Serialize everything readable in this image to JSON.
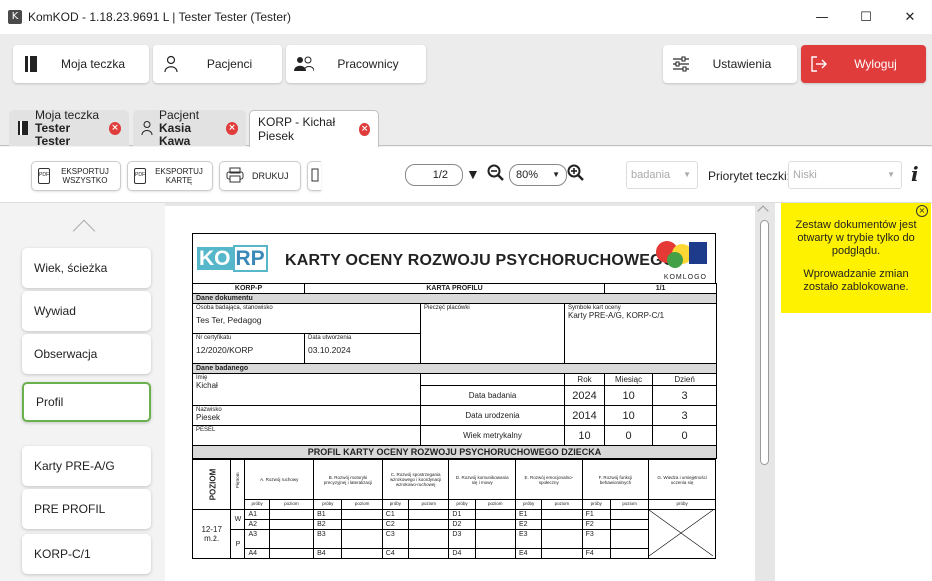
{
  "window": {
    "title": "KomKOD - 1.18.23.9691 L | Tester Tester (Tester)",
    "app_icon": "K",
    "minimize": "—",
    "maximize": "☐",
    "close": "✕"
  },
  "topnav": {
    "moja_teczka": "Moja teczka",
    "pacjenci": "Pacjenci",
    "pracownicy": "Pracownicy",
    "ustawienia": "Ustawienia",
    "wyloguj": "Wyloguj"
  },
  "tabs": [
    {
      "line1": "Moja teczka",
      "line2": "Tester Tester"
    },
    {
      "line1": "Pacjent",
      "line2": "Kasia Kawa"
    },
    {
      "label": "KORP - Kichał Piesek"
    }
  ],
  "toolbar": {
    "export_all": "EKSPORTUJ WSZYSTKO",
    "export_card": "EKSPORTUJ KARTĘ",
    "print": "DRUKUJ",
    "page": "1/2",
    "zoom": "80%",
    "badania_value": "badania",
    "priority_label": "Priorytet teczki:",
    "priority_value": "Niski",
    "info": "i"
  },
  "sidebar": [
    "Wiek, ścieżka",
    "Wywiad",
    "Obserwacja",
    "Profil",
    "Karty PRE-A/G",
    "PRE PROFIL",
    "KORP-C/1"
  ],
  "notice": {
    "line1": "Zestaw dokumentów jest otwarty w trybie tylko do podglądu.",
    "line2": "Wprowadzanie zmian zostało zablokowane."
  },
  "accent": {
    "red": "#e03c3c",
    "green": "#6ab04c",
    "yellow": "#fff200"
  },
  "document": {
    "logo_k": "KO",
    "logo_rp": "RP",
    "title": "KARTY OCENY ROZWOJU PSYCHORUCHOWEGO",
    "komlogo": "KOMLOGO",
    "row1": {
      "code": "KORP-P",
      "name": "KARTA PROFILU",
      "page": "1/1"
    },
    "dane_dokumentu": "Dane dokumentu",
    "osoba_label": "Osoba badająca, stanowisko",
    "osoba_value": "Tes Ter, Pedagog",
    "pieczec_label": "Pieczęć placówki",
    "symbole_label": "Symbole kart oceny",
    "symbole_value": "Karty PRE-A/G, KORP-C/1",
    "cert_label": "Nr certyfikatu",
    "cert_value": "12/2020/KORP",
    "data_utw_label": "Data utworzenia",
    "data_utw_value": "03.10.2024",
    "dane_badanego": "Dane badanego",
    "imie_label": "Imię",
    "imie_value": "Kichał",
    "nazwisko_label": "Nazwisko",
    "nazwisko_value": "Piesek",
    "pesel_label": "PESEL",
    "rok": "Rok",
    "miesiac": "Miesiąc",
    "dzien": "Dzień",
    "data_badania_label": "Data badania",
    "data_badania": [
      "2024",
      "10",
      "3"
    ],
    "data_urodzenia_label": "Data urodzenia",
    "data_urodzenia": [
      "2014",
      "10",
      "3"
    ],
    "wiek_label": "Wiek metrykalny",
    "wiek": [
      "10",
      "0",
      "0"
    ],
    "profil_title": "PROFIL KARTY OCENY ROZWOJU PSYCHORUCHOWEGO DZIECKA",
    "poziom": "POZIOM",
    "pietro": "Piętrom",
    "domains": [
      "A. Rozwój ruchowy",
      "B. Rozwój motoryki precyzyjnej i lateralizacji",
      "C. Rozwój spostrzegania wzrokowego i koordynacji wzrokowo-ruchowej",
      "D. Rozwój komunikowania się i mowy",
      "E. Rozwój emocjonalno-społeczny",
      "F. Rozwój funkcji behawioralnych",
      "G. Wiedza i umiejętności uczenia się"
    ],
    "proby": "próby",
    "poziom_col": "poziom",
    "age_label": "12-17 m.ż.",
    "levels": [
      "W",
      "P"
    ],
    "rows": [
      [
        "A1",
        "B1",
        "C1",
        "D1",
        "E1",
        "F1"
      ],
      [
        "A2",
        "B2",
        "C2",
        "D2",
        "E2",
        "F2"
      ],
      [
        "A3",
        "B3",
        "C3",
        "D3",
        "E3",
        "F3"
      ],
      [
        "A4",
        "B4",
        "C4",
        "D4",
        "E4",
        "F4"
      ]
    ]
  }
}
